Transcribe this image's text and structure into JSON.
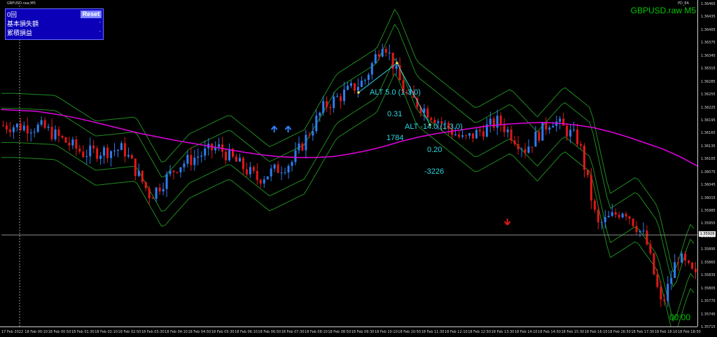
{
  "window": {
    "title": "GBPUSD.raw,M5",
    "ea_label": "PD_EA",
    "symbol_label": "GBPUSD.raw M5",
    "clock": "00:00"
  },
  "panel": {
    "count_label": "0回",
    "reset_label": "Reset",
    "row2_label": "基本損失額",
    "row3_label": "累積損益",
    "row2_value": "-",
    "row3_value": "-"
  },
  "annotations": {
    "alt_up": "ALT 5.0 (1-3.0)",
    "alt_down": "ALT -14.0 (1-3.0)",
    "value_031": "0.31",
    "value_1784": "1784",
    "value_020": "0.20",
    "value_neg3226": "-3226"
  },
  "price_axis": {
    "labels": [
      "1.36465",
      "1.36435",
      "1.36405",
      "1.36375",
      "1.36345",
      "1.36315",
      "1.36285",
      "1.36255",
      "1.36225",
      "1.36195",
      "1.36165",
      "1.36135",
      "1.36105",
      "1.36075",
      "1.36045",
      "1.36015",
      "1.35985",
      "1.35955",
      "1.35925",
      "1.35895",
      "1.35865",
      "1.35835",
      "1.35805",
      "1.35775",
      "1.35745",
      "1.35715"
    ],
    "current_price": "1.35929"
  },
  "time_axis": {
    "labels": [
      "17 Feb 2022",
      "18 Feb 00:10",
      "18 Feb 00:50",
      "18 Feb 01:30",
      "18 Feb 02:10",
      "18 Feb 02:50",
      "18 Feb 03:30",
      "18 Feb 04:10",
      "18 Feb 04:50",
      "18 Feb 05:30",
      "18 Feb 06:10",
      "18 Feb 06:50",
      "18 Feb 07:30",
      "18 Feb 08:10",
      "18 Feb 08:50",
      "18 Feb 09:30",
      "18 Feb 10:10",
      "18 Feb 10:50",
      "18 Feb 11:30",
      "18 Feb 12:10",
      "18 Feb 12:50",
      "18 Feb 13:30",
      "18 Feb 14:10",
      "18 Feb 14:50",
      "18 Feb 15:30",
      "18 Feb 16:10",
      "18 Feb 16:50",
      "18 Feb 17:30",
      "18 Feb 18:10",
      "18 Feb 18:50"
    ]
  },
  "colors": {
    "bull": "#2e7df0",
    "bear": "#e01818",
    "ma": "#e000e0",
    "band": "#1f8a1f",
    "text_accent": "#2bd6e0",
    "panel_bg": "#0b00b8",
    "symbol": "#00c800"
  },
  "chart_data": {
    "type": "candlestick",
    "series_ma": [
      1.36222,
      1.3622,
      1.36218,
      1.36212,
      1.36205,
      1.36196,
      1.36186,
      1.36176,
      1.36166,
      1.36158,
      1.3615,
      1.36143,
      1.36136,
      1.36129,
      1.36122,
      1.36116,
      1.36112,
      1.3611,
      1.3611,
      1.36112,
      1.36118,
      1.36126,
      1.36136,
      1.36148,
      1.36158,
      1.36166,
      1.36172,
      1.36178,
      1.36184,
      1.36188,
      1.3619,
      1.36192,
      1.3619,
      1.36186,
      1.3618,
      1.3617,
      1.36158,
      1.36144,
      1.3613,
      1.36112,
      1.3609
    ],
    "markers": [
      {
        "type": "buy",
        "index": 78
      },
      {
        "type": "buy",
        "index": 82
      },
      {
        "type": "sell",
        "index": 145
      }
    ]
  }
}
